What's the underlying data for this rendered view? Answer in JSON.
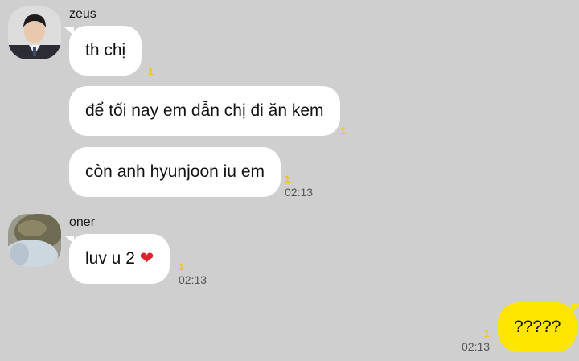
{
  "chat": {
    "group1": {
      "sender": "zeus",
      "messages": [
        {
          "text": "th chị",
          "unread": "1"
        },
        {
          "text": "để tối nay em dẫn chị đi ăn kem",
          "unread": "1"
        },
        {
          "text": "còn anh hyunjoon iu em",
          "unread": "1",
          "time": "02:13"
        }
      ]
    },
    "group2": {
      "sender": "oner",
      "messages": [
        {
          "text": "luv u 2",
          "emoji": "❤",
          "unread": "1",
          "time": "02:13"
        }
      ]
    },
    "mine": {
      "messages": [
        {
          "text": "?????",
          "unread": "1",
          "time": "02:13"
        }
      ]
    }
  },
  "colors": {
    "background": "#cfcfcf",
    "bubble_in": "#ffffff",
    "bubble_out": "#fee500",
    "unread": "#f5c400"
  }
}
